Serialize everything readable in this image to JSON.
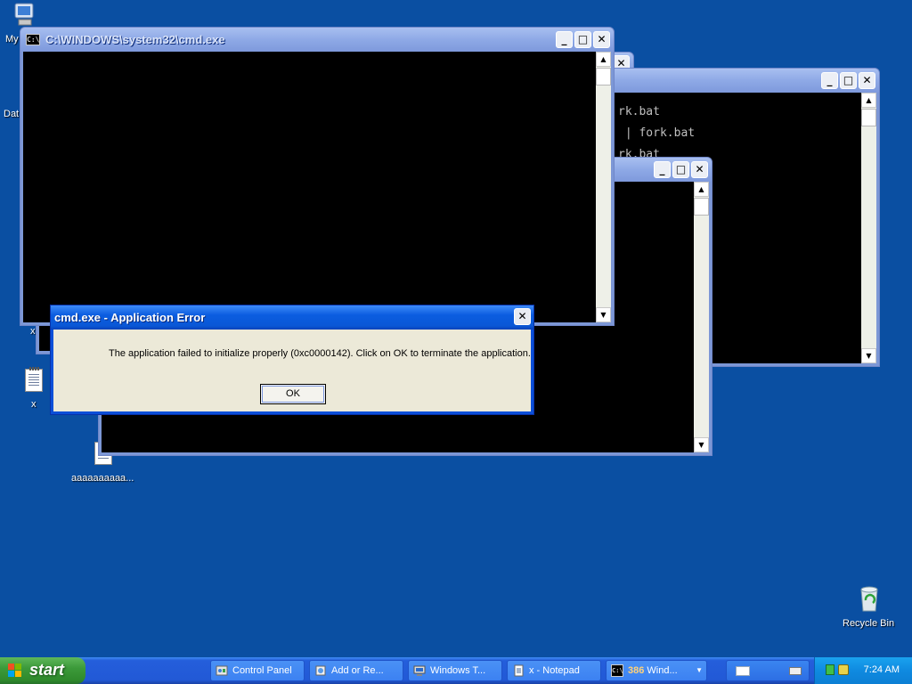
{
  "desktop_icons": {
    "my_computer_label": "My",
    "data_label": "Dat",
    "x_label_top": "x",
    "x_label": "x",
    "aaaa_label": "aaaaaaaaaa...",
    "recycle_bin_label": "Recycle Bin"
  },
  "windows": {
    "main_cmd": {
      "title": "C:\\WINDOWS\\system32\\cmd.exe"
    },
    "right_cmd": {
      "lines": [
        "rk.bat",
        " | fork.bat",
        "rk.bat"
      ]
    }
  },
  "dialog": {
    "title": "cmd.exe - Application Error",
    "message": "The application failed to initialize properly (0xc0000142). Click on OK to terminate the application.",
    "ok_label": "OK"
  },
  "taskbar": {
    "start_label": "start",
    "items": [
      {
        "label": "Control Panel"
      },
      {
        "label": "Add or Re..."
      },
      {
        "label": "Windows T..."
      },
      {
        "label": "x - Notepad"
      },
      {
        "count": "386",
        "label": "Wind..."
      }
    ],
    "clock": "7:24 AM"
  },
  "colors": {
    "desktop": "#0a4fa2",
    "titlebar_active": "#0b5de0",
    "dialog_face": "#ece9d8"
  }
}
